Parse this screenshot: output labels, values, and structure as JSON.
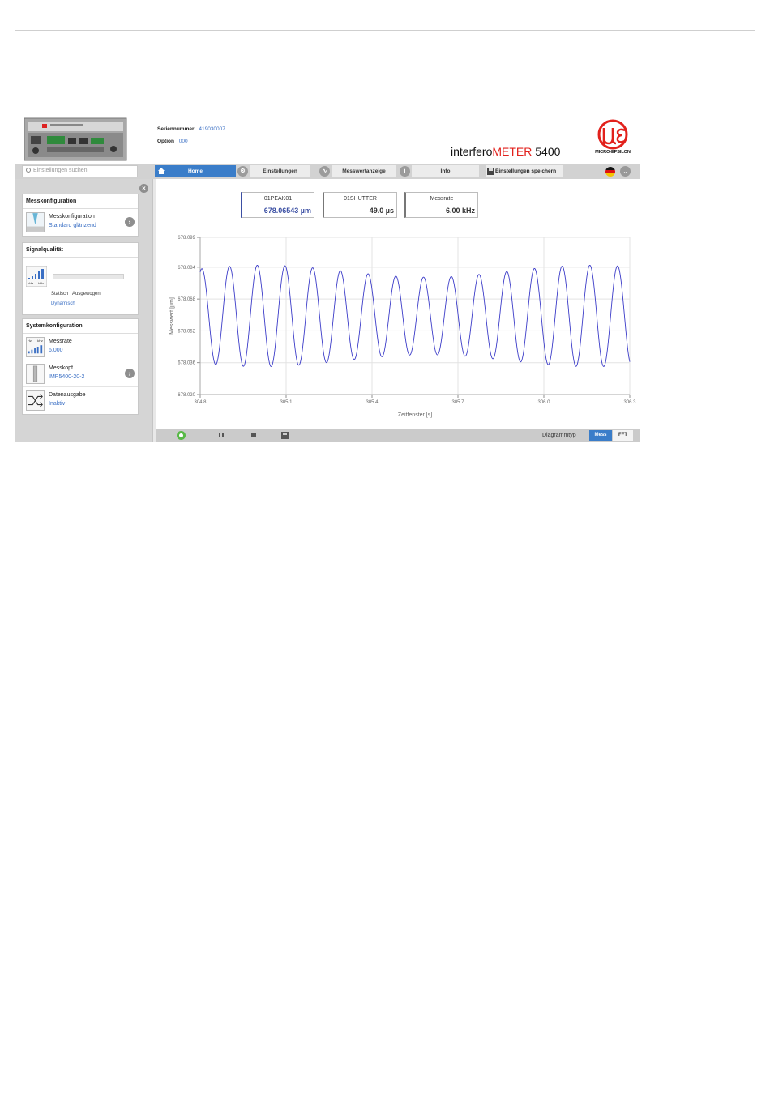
{
  "header": {
    "serial_label": "Seriennummer",
    "serial_value": "419030007",
    "option_label": "Option",
    "option_value": "000",
    "product_prefix": "interfero",
    "product_highlight": "METER",
    "product_suffix": " 5400",
    "logo_text": "MICRO-EPSILON"
  },
  "nav": {
    "search_placeholder": "Einstellungen suchen",
    "tabs": [
      {
        "label": "Home",
        "active": true
      },
      {
        "label": "Einstellungen"
      },
      {
        "label": "Messwertanzeige"
      },
      {
        "label": "Info"
      }
    ],
    "save_label": "Einstellungen speichern",
    "language_icon": "flag-germany-icon"
  },
  "sidebar": {
    "messkonfiguration": {
      "title": "Messkonfiguration",
      "items": [
        {
          "label": "Messkonfiguration",
          "value": "Standard glänzend"
        }
      ]
    },
    "signalqualitaet": {
      "title": "Signalqualität",
      "unit_left": "µHz",
      "unit_right": "kHz",
      "slider_left": "Statisch",
      "slider_middle": "Ausgewogen",
      "slider_right": "Dynamisch"
    },
    "systemkonfiguration": {
      "title": "Systemkonfiguration",
      "items": [
        {
          "label": "Messrate",
          "value": "6.000",
          "thumb_left": "Hz",
          "thumb_right": "kHz"
        },
        {
          "label": "Messkopf",
          "value": "IMP5400-20-2"
        },
        {
          "label": "Datenausgabe",
          "value": "Inaktiv"
        }
      ]
    }
  },
  "values": [
    {
      "label": "01PEAK01",
      "value": "678.06543 µm"
    },
    {
      "label": "01SHUTTER",
      "value": "49.0 µs"
    },
    {
      "label": "Messrate",
      "value": "6.00 kHz"
    }
  ],
  "chart_data": {
    "type": "line",
    "title": "",
    "xlabel": "Zeitfenster [s]",
    "ylabel": "Messwert [µm]",
    "xlim": [
      304.8,
      306.3
    ],
    "ylim": [
      678.02,
      678.099
    ],
    "xticks": [
      "304.8",
      "305.1",
      "305.4",
      "305.7",
      "306.0",
      "306.3"
    ],
    "yticks": [
      "678.099",
      "678.084",
      "678.068",
      "678.052",
      "678.036",
      "678.020"
    ],
    "grid": true,
    "series_color": "#3b3bc8",
    "sine": {
      "cycles": 15.5,
      "phase_start": 1.2,
      "center": 678.0595,
      "amplitude": 0.0225,
      "amplitude_variation": 0.003
    }
  },
  "toolbar": {
    "diagram_label": "Diagrammtyp",
    "mess_label": "Mess",
    "fft_label": "FFT"
  }
}
